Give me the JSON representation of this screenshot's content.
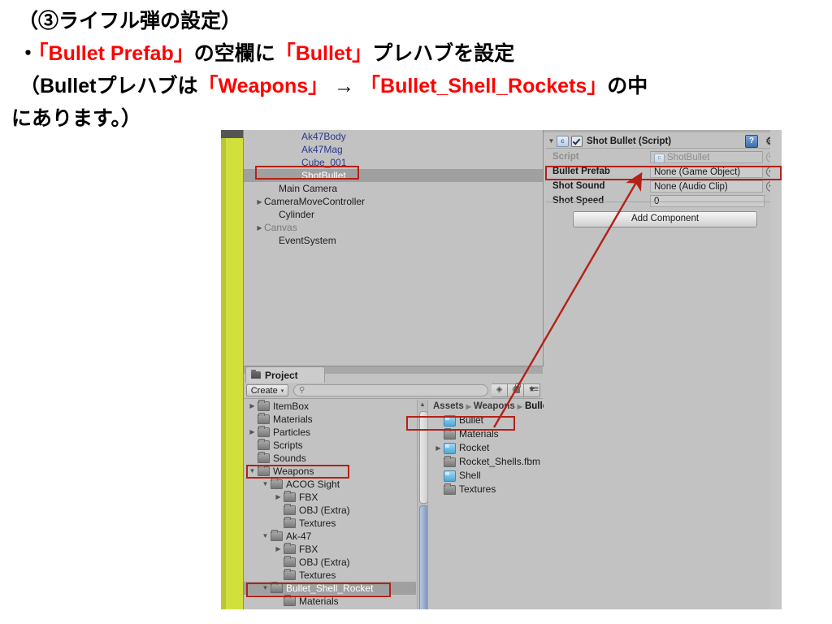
{
  "slide": {
    "lines": [
      {
        "id": "l1",
        "segments": [
          {
            "text": "（③ライフル弾の設定）",
            "color": "black"
          }
        ]
      },
      {
        "id": "l2",
        "segments": [
          {
            "text": "・",
            "color": "black"
          },
          {
            "text": "「Bullet Prefab」",
            "color": "red"
          },
          {
            "text": "の空欄に",
            "color": "black"
          },
          {
            "text": "「Bullet」",
            "color": "red"
          },
          {
            "text": "プレハブを設定",
            "color": "black"
          }
        ]
      },
      {
        "id": "l3",
        "segments": [
          {
            "text": "（Bulletプレハブは",
            "color": "black"
          },
          {
            "text": "「Weapons」",
            "color": "red"
          },
          {
            "text": "→",
            "color": "black"
          },
          {
            "text": "「Bullet_Shell_Rockets」",
            "color": "red"
          },
          {
            "text": "の中",
            "color": "black"
          }
        ]
      },
      {
        "id": "l4",
        "segments": [
          {
            "text": "にあります。）",
            "color": "black"
          }
        ]
      }
    ],
    "line1": "（③ライフル弾の設定）",
    "line2_a": "・",
    "line2_b": "「Bullet Prefab」",
    "line2_c": "の空欄に",
    "line2_d": "「Bullet」",
    "line2_e": "プレハブを設定",
    "line3_a": "（Bulletプレハブは",
    "line3_b": "「Weapons」",
    "line3_c": " → ",
    "line3_d": "「Bullet_Shell_Rockets」",
    "line3_e": "の中",
    "line4": "にあります。）"
  },
  "unity": {
    "hierarchy": {
      "rows": [
        {
          "label": "Ak47Body",
          "indent": 3,
          "tri": "none",
          "style": "prefab",
          "selected": false
        },
        {
          "label": "Ak47Mag",
          "indent": 3,
          "tri": "none",
          "style": "prefab",
          "selected": false
        },
        {
          "label": "Cube_001",
          "indent": 3,
          "tri": "none",
          "style": "prefab",
          "selected": false
        },
        {
          "label": "ShotBullet",
          "indent": 3,
          "tri": "none",
          "style": "prefab",
          "selected": true
        },
        {
          "label": "Main Camera",
          "indent": 2,
          "tri": "none",
          "style": "normal",
          "selected": false
        },
        {
          "label": "CameraMoveController",
          "indent": 1,
          "tri": "right",
          "style": "normal",
          "selected": false
        },
        {
          "label": "Cylinder",
          "indent": 2,
          "tri": "none",
          "style": "normal",
          "selected": false
        },
        {
          "label": "Canvas",
          "indent": 1,
          "tri": "right",
          "style": "disabled",
          "selected": false
        },
        {
          "label": "EventSystem",
          "indent": 2,
          "tri": "none",
          "style": "normal",
          "selected": false
        }
      ]
    },
    "inspector": {
      "component_title": "Shot Bullet (Script)",
      "enabled_checkbox": true,
      "script_badge_letter": "c",
      "help_icon": "?",
      "gear_icon": "⚙",
      "properties": [
        {
          "label": "Script",
          "value": "ShotBullet",
          "dim": true,
          "has_badge": true,
          "selector": "faint",
          "boxed": false
        },
        {
          "label": "Bullet Prefab",
          "value": "None (Game Object)",
          "dim": false,
          "has_badge": false,
          "selector": "normal",
          "boxed": true
        },
        {
          "label": "Shot Sound",
          "value": "None (Audio Clip)",
          "dim": false,
          "has_badge": false,
          "selector": "normal",
          "boxed": false
        },
        {
          "label": "Shot Speed",
          "value": "0",
          "dim": false,
          "has_badge": false,
          "selector": "none",
          "boxed": false
        }
      ],
      "add_component_label": "Add Component"
    },
    "project": {
      "tab_label": "Project",
      "create_label": "Create",
      "create_caret": "▾",
      "search_placeholder": "",
      "search_icon": "🔍",
      "search_value": "",
      "tool_icons": [
        "▞",
        "▚",
        "★"
      ],
      "lock_icon": "lock",
      "menu_icon": "▾≡",
      "tree": [
        {
          "label": "ItemBox",
          "indent": 1,
          "tri": "right",
          "icon": "folder",
          "selected": false
        },
        {
          "label": "Materials",
          "indent": 1,
          "tri": "none",
          "icon": "folder",
          "selected": false
        },
        {
          "label": "Particles",
          "indent": 1,
          "tri": "right",
          "icon": "folder",
          "selected": false
        },
        {
          "label": "Scripts",
          "indent": 1,
          "tri": "none",
          "icon": "folder",
          "selected": false
        },
        {
          "label": "Sounds",
          "indent": 1,
          "tri": "none",
          "icon": "folder",
          "selected": false
        },
        {
          "label": "Weapons",
          "indent": 1,
          "tri": "down",
          "icon": "folder",
          "selected": false
        },
        {
          "label": "ACOG Sight",
          "indent": 2,
          "tri": "down",
          "icon": "folder",
          "selected": false
        },
        {
          "label": "FBX",
          "indent": 3,
          "tri": "right",
          "icon": "folder",
          "selected": false
        },
        {
          "label": "OBJ (Extra)",
          "indent": 3,
          "tri": "none",
          "icon": "folder",
          "selected": false
        },
        {
          "label": "Textures",
          "indent": 3,
          "tri": "none",
          "icon": "folder",
          "selected": false
        },
        {
          "label": "Ak-47",
          "indent": 2,
          "tri": "down",
          "icon": "folder",
          "selected": false
        },
        {
          "label": "FBX",
          "indent": 3,
          "tri": "right",
          "icon": "folder",
          "selected": false
        },
        {
          "label": "OBJ (Extra)",
          "indent": 3,
          "tri": "none",
          "icon": "folder",
          "selected": false
        },
        {
          "label": "Textures",
          "indent": 3,
          "tri": "none",
          "icon": "folder",
          "selected": false
        },
        {
          "label": "Bullet_Shell_Rocket",
          "indent": 2,
          "tri": "down",
          "icon": "folder",
          "selected": true
        },
        {
          "label": "Materials",
          "indent": 3,
          "tri": "none",
          "icon": "folder",
          "selected": false
        }
      ],
      "breadcrumb": [
        "Assets",
        "Weapons",
        "Bulle"
      ],
      "content": [
        {
          "label": "Bullet",
          "icon": "prefab",
          "tri": "none",
          "boxed": true
        },
        {
          "label": "Materials",
          "icon": "folder",
          "tri": "none",
          "boxed": false
        },
        {
          "label": "Rocket",
          "icon": "prefab",
          "tri": "right",
          "boxed": false
        },
        {
          "label": "Rocket_Shells.fbm",
          "icon": "folder",
          "tri": "none",
          "boxed": false
        },
        {
          "label": "Shell",
          "icon": "prefab",
          "tri": "none",
          "boxed": false
        },
        {
          "label": "Textures",
          "icon": "folder",
          "tri": "none",
          "boxed": false
        }
      ]
    },
    "annotation": {
      "accent_color": "#b42118",
      "arrow_from": "Bullet asset in project window",
      "arrow_to": "Bullet Prefab field in inspector"
    }
  }
}
